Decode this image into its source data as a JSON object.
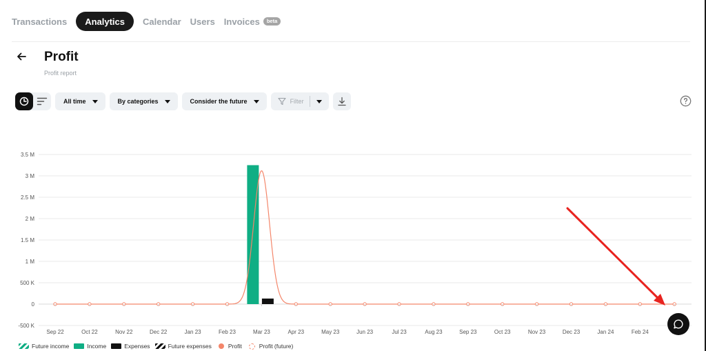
{
  "tabs": [
    {
      "label": "Transactions",
      "active": false
    },
    {
      "label": "Analytics",
      "active": true
    },
    {
      "label": "Calendar",
      "active": false
    },
    {
      "label": "Users",
      "active": false
    },
    {
      "label": "Invoices",
      "active": false,
      "badge": "beta"
    }
  ],
  "header": {
    "title": "Profit",
    "subtitle": "Profit report"
  },
  "toolbar": {
    "view_modes": [
      {
        "icon": "pie-chart-icon",
        "active": true
      },
      {
        "icon": "list-icon",
        "active": false
      }
    ],
    "period": "All time",
    "grouping": "By categories",
    "future": "Consider the future",
    "filter": "Filter",
    "download_icon": "download-icon"
  },
  "help_icon": "question-circle-icon",
  "chat_icon": "chat-bubble-icon",
  "colors": {
    "income": "#0fae84",
    "expenses": "#111111",
    "profit": "#f4866a",
    "annotation_arrow": "#e8231f"
  },
  "chart_data": {
    "type": "bar",
    "title": "",
    "xlabel": "",
    "ylabel": "",
    "categories": [
      "Sep 22",
      "Oct 22",
      "Nov 22",
      "Dec 22",
      "Jan 23",
      "Feb 23",
      "Mar 23",
      "Apr 23",
      "May 23",
      "Jun 23",
      "Jul 23",
      "Aug 23",
      "Sep 23",
      "Oct 23",
      "Nov 23",
      "Dec 23",
      "Jan 24",
      "Feb 24",
      "Mar 24"
    ],
    "visible_tick_labels": [
      "Sep 22",
      "Oct 22",
      "Nov 22",
      "Dec 22",
      "Jan 23",
      "Feb 23",
      "Mar 23",
      "Apr 23",
      "May 23",
      "Jun 23",
      "Jul 23",
      "Aug 23",
      "Sep 23",
      "Oct 23",
      "Nov 23",
      "Dec 23",
      "Jan 24",
      "Feb 24",
      "M"
    ],
    "ylim": [
      -500000,
      3500000
    ],
    "yticks": [
      -500000,
      0,
      500000,
      1000000,
      1500000,
      2000000,
      2500000,
      3000000,
      3500000
    ],
    "ytick_labels": [
      "-500 K",
      "0",
      "500 K",
      "1 M",
      "1.5 M",
      "2 M",
      "2.5 M",
      "3 M",
      "3.5 M"
    ],
    "grid": true,
    "series": [
      {
        "name": "Income",
        "type": "bar",
        "values": [
          0,
          0,
          0,
          0,
          0,
          0,
          3250000,
          0,
          0,
          0,
          0,
          0,
          0,
          0,
          0,
          0,
          0,
          0,
          0
        ]
      },
      {
        "name": "Expenses",
        "type": "bar",
        "values": [
          0,
          0,
          0,
          0,
          0,
          0,
          130000,
          0,
          0,
          0,
          0,
          0,
          0,
          0,
          0,
          0,
          0,
          0,
          0
        ]
      },
      {
        "name": "Profit",
        "type": "line",
        "values": [
          0,
          0,
          0,
          0,
          0,
          0,
          3120000,
          0,
          0,
          0,
          0,
          0,
          0,
          0,
          0,
          0,
          0,
          0,
          0
        ]
      }
    ],
    "legend": {
      "position": "bottom-left",
      "items": [
        "Future income",
        "Income",
        "Expenses",
        "Future expenses",
        "Profit",
        "Profit (future)"
      ]
    }
  }
}
